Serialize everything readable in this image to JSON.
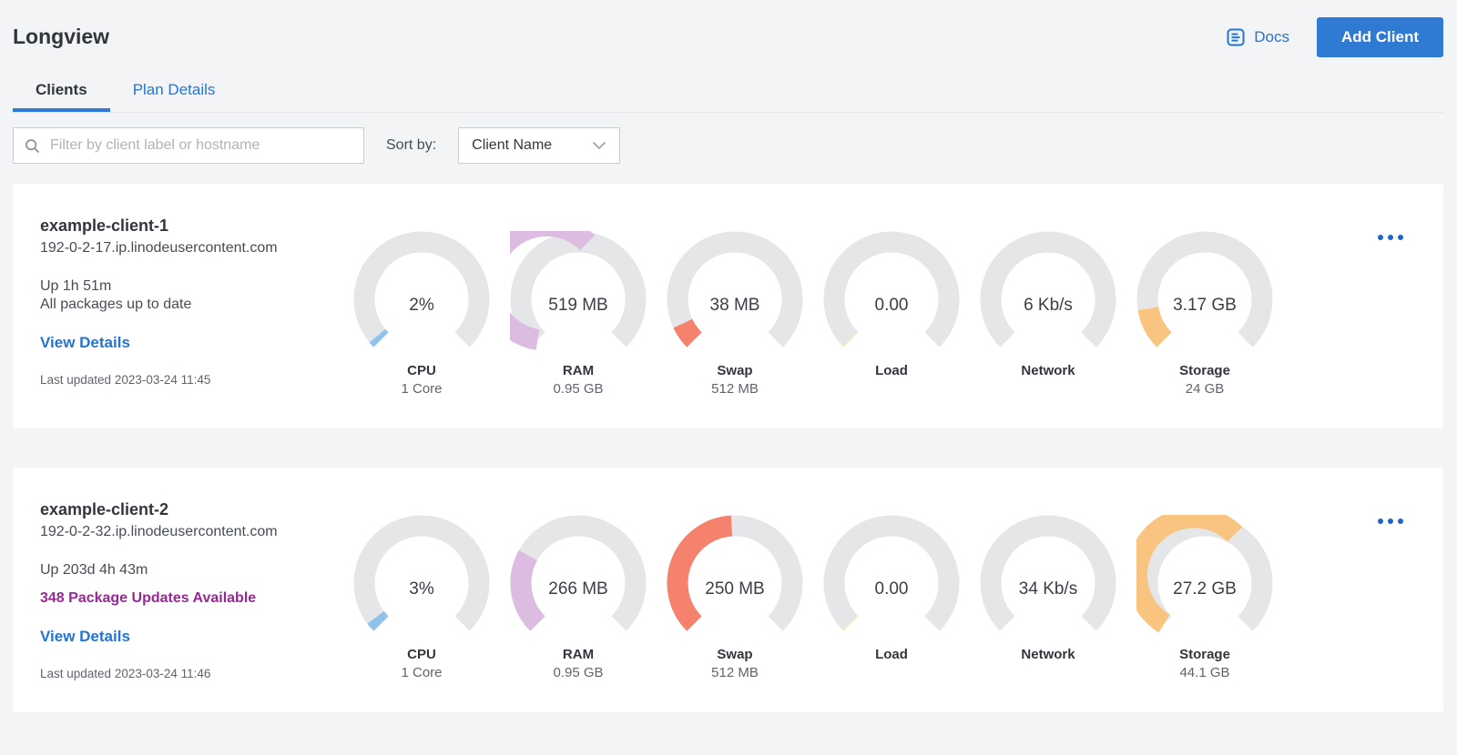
{
  "header": {
    "title": "Longview",
    "docs_label": "Docs",
    "add_client_label": "Add Client"
  },
  "tabs": [
    {
      "label": "Clients",
      "active": true
    },
    {
      "label": "Plan Details",
      "active": false
    }
  ],
  "filter": {
    "placeholder": "Filter by client label or hostname",
    "value": "",
    "sort_label": "Sort by:",
    "sort_value": "Client Name"
  },
  "colors": {
    "accent_blue": "#2f7bd3",
    "link_blue": "#2575d0",
    "kebab_blue": "#1f65c5",
    "alert_purple": "#982796",
    "gauge_track": "#e5e6e7",
    "gauge_cpu": "#90c2ee",
    "gauge_ram": "#dcbce0",
    "gauge_swap": "#f5826c",
    "gauge_load": "#f7ecbc",
    "gauge_storage": "#f9c480"
  },
  "clients": [
    {
      "name": "example-client-1",
      "hostname": "192-0-2-17.ip.linodeusercontent.com",
      "uptime": "Up 1h 51m",
      "packages": "All packages up to date",
      "packages_alert": false,
      "view_details": "View Details",
      "last_updated": "Last updated 2023-03-24 11:45",
      "gauges": [
        {
          "label": "CPU",
          "value": "2%",
          "sub": "1 Core",
          "fraction": 0.02,
          "color": "#90c2ee"
        },
        {
          "label": "RAM",
          "value": "519 MB",
          "sub": "0.95 GB",
          "fraction": 0.534,
          "color": "#dcbce0"
        },
        {
          "label": "Swap",
          "value": "38 MB",
          "sub": "512 MB",
          "fraction": 0.074,
          "color": "#f5826c"
        },
        {
          "label": "Load",
          "value": "0.00",
          "sub": "",
          "fraction": 0.005,
          "color": "#f7ecbc"
        },
        {
          "label": "Network",
          "value": "6 Kb/s",
          "sub": "",
          "fraction": 0,
          "color": "#e5e6e7"
        },
        {
          "label": "Storage",
          "value": "3.17 GB",
          "sub": "24 GB",
          "fraction": 0.132,
          "color": "#f9c480"
        }
      ]
    },
    {
      "name": "example-client-2",
      "hostname": "192-0-2-32.ip.linodeusercontent.com",
      "uptime": "Up 203d 4h 43m",
      "packages": "348 Package Updates Available",
      "packages_alert": true,
      "view_details": "View Details",
      "last_updated": "Last updated 2023-03-24 11:46",
      "gauges": [
        {
          "label": "CPU",
          "value": "3%",
          "sub": "1 Core",
          "fraction": 0.03,
          "color": "#90c2ee"
        },
        {
          "label": "RAM",
          "value": "266 MB",
          "sub": "0.95 GB",
          "fraction": 0.274,
          "color": "#dcbce0"
        },
        {
          "label": "Swap",
          "value": "250 MB",
          "sub": "512 MB",
          "fraction": 0.488,
          "color": "#f5826c"
        },
        {
          "label": "Load",
          "value": "0.00",
          "sub": "",
          "fraction": 0.005,
          "color": "#f7ecbc"
        },
        {
          "label": "Network",
          "value": "34 Kb/s",
          "sub": "",
          "fraction": 0,
          "color": "#e5e6e7"
        },
        {
          "label": "Storage",
          "value": "27.2 GB",
          "sub": "44.1 GB",
          "fraction": 0.617,
          "color": "#f9c480"
        }
      ]
    }
  ]
}
